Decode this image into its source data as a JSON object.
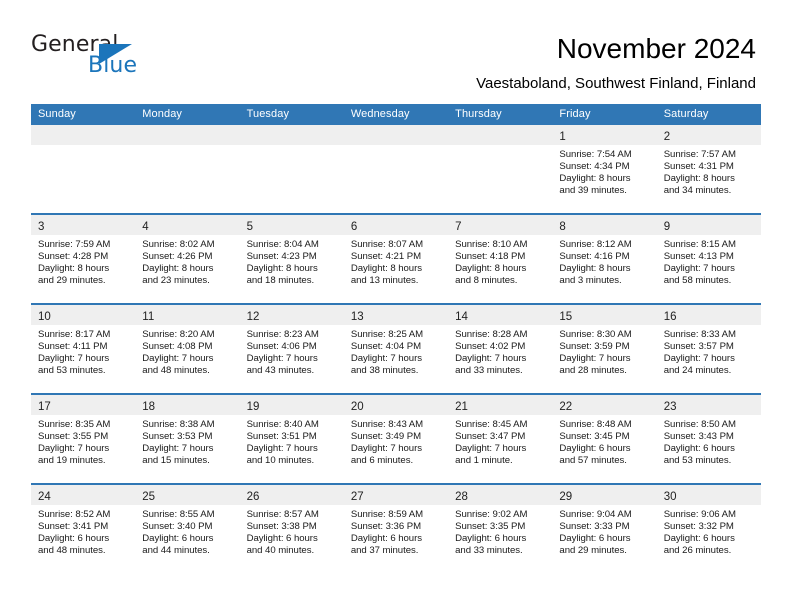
{
  "brand": {
    "name_part1": "General",
    "name_part2": "Blue",
    "accent_color": "#1b75bb",
    "logo_icon": "triangle-flag-icon"
  },
  "header": {
    "title": "November 2024",
    "subtitle": "Vaestaboland, Southwest Finland, Finland"
  },
  "theme": {
    "header_blue": "#3077b5",
    "date_strip_gray": "#efefef",
    "text_color": "#1a1a1a"
  },
  "weekday_headers": [
    "Sunday",
    "Monday",
    "Tuesday",
    "Wednesday",
    "Thursday",
    "Friday",
    "Saturday"
  ],
  "weeks": [
    [
      {
        "day": "",
        "lines": []
      },
      {
        "day": "",
        "lines": []
      },
      {
        "day": "",
        "lines": []
      },
      {
        "day": "",
        "lines": []
      },
      {
        "day": "",
        "lines": []
      },
      {
        "day": "1",
        "lines": [
          "Sunrise: 7:54 AM",
          "Sunset: 4:34 PM",
          "Daylight: 8 hours",
          "and 39 minutes."
        ]
      },
      {
        "day": "2",
        "lines": [
          "Sunrise: 7:57 AM",
          "Sunset: 4:31 PM",
          "Daylight: 8 hours",
          "and 34 minutes."
        ]
      }
    ],
    [
      {
        "day": "3",
        "lines": [
          "Sunrise: 7:59 AM",
          "Sunset: 4:28 PM",
          "Daylight: 8 hours",
          "and 29 minutes."
        ]
      },
      {
        "day": "4",
        "lines": [
          "Sunrise: 8:02 AM",
          "Sunset: 4:26 PM",
          "Daylight: 8 hours",
          "and 23 minutes."
        ]
      },
      {
        "day": "5",
        "lines": [
          "Sunrise: 8:04 AM",
          "Sunset: 4:23 PM",
          "Daylight: 8 hours",
          "and 18 minutes."
        ]
      },
      {
        "day": "6",
        "lines": [
          "Sunrise: 8:07 AM",
          "Sunset: 4:21 PM",
          "Daylight: 8 hours",
          "and 13 minutes."
        ]
      },
      {
        "day": "7",
        "lines": [
          "Sunrise: 8:10 AM",
          "Sunset: 4:18 PM",
          "Daylight: 8 hours",
          "and 8 minutes."
        ]
      },
      {
        "day": "8",
        "lines": [
          "Sunrise: 8:12 AM",
          "Sunset: 4:16 PM",
          "Daylight: 8 hours",
          "and 3 minutes."
        ]
      },
      {
        "day": "9",
        "lines": [
          "Sunrise: 8:15 AM",
          "Sunset: 4:13 PM",
          "Daylight: 7 hours",
          "and 58 minutes."
        ]
      }
    ],
    [
      {
        "day": "10",
        "lines": [
          "Sunrise: 8:17 AM",
          "Sunset: 4:11 PM",
          "Daylight: 7 hours",
          "and 53 minutes."
        ]
      },
      {
        "day": "11",
        "lines": [
          "Sunrise: 8:20 AM",
          "Sunset: 4:08 PM",
          "Daylight: 7 hours",
          "and 48 minutes."
        ]
      },
      {
        "day": "12",
        "lines": [
          "Sunrise: 8:23 AM",
          "Sunset: 4:06 PM",
          "Daylight: 7 hours",
          "and 43 minutes."
        ]
      },
      {
        "day": "13",
        "lines": [
          "Sunrise: 8:25 AM",
          "Sunset: 4:04 PM",
          "Daylight: 7 hours",
          "and 38 minutes."
        ]
      },
      {
        "day": "14",
        "lines": [
          "Sunrise: 8:28 AM",
          "Sunset: 4:02 PM",
          "Daylight: 7 hours",
          "and 33 minutes."
        ]
      },
      {
        "day": "15",
        "lines": [
          "Sunrise: 8:30 AM",
          "Sunset: 3:59 PM",
          "Daylight: 7 hours",
          "and 28 minutes."
        ]
      },
      {
        "day": "16",
        "lines": [
          "Sunrise: 8:33 AM",
          "Sunset: 3:57 PM",
          "Daylight: 7 hours",
          "and 24 minutes."
        ]
      }
    ],
    [
      {
        "day": "17",
        "lines": [
          "Sunrise: 8:35 AM",
          "Sunset: 3:55 PM",
          "Daylight: 7 hours",
          "and 19 minutes."
        ]
      },
      {
        "day": "18",
        "lines": [
          "Sunrise: 8:38 AM",
          "Sunset: 3:53 PM",
          "Daylight: 7 hours",
          "and 15 minutes."
        ]
      },
      {
        "day": "19",
        "lines": [
          "Sunrise: 8:40 AM",
          "Sunset: 3:51 PM",
          "Daylight: 7 hours",
          "and 10 minutes."
        ]
      },
      {
        "day": "20",
        "lines": [
          "Sunrise: 8:43 AM",
          "Sunset: 3:49 PM",
          "Daylight: 7 hours",
          "and 6 minutes."
        ]
      },
      {
        "day": "21",
        "lines": [
          "Sunrise: 8:45 AM",
          "Sunset: 3:47 PM",
          "Daylight: 7 hours",
          "and 1 minute."
        ]
      },
      {
        "day": "22",
        "lines": [
          "Sunrise: 8:48 AM",
          "Sunset: 3:45 PM",
          "Daylight: 6 hours",
          "and 57 minutes."
        ]
      },
      {
        "day": "23",
        "lines": [
          "Sunrise: 8:50 AM",
          "Sunset: 3:43 PM",
          "Daylight: 6 hours",
          "and 53 minutes."
        ]
      }
    ],
    [
      {
        "day": "24",
        "lines": [
          "Sunrise: 8:52 AM",
          "Sunset: 3:41 PM",
          "Daylight: 6 hours",
          "and 48 minutes."
        ]
      },
      {
        "day": "25",
        "lines": [
          "Sunrise: 8:55 AM",
          "Sunset: 3:40 PM",
          "Daylight: 6 hours",
          "and 44 minutes."
        ]
      },
      {
        "day": "26",
        "lines": [
          "Sunrise: 8:57 AM",
          "Sunset: 3:38 PM",
          "Daylight: 6 hours",
          "and 40 minutes."
        ]
      },
      {
        "day": "27",
        "lines": [
          "Sunrise: 8:59 AM",
          "Sunset: 3:36 PM",
          "Daylight: 6 hours",
          "and 37 minutes."
        ]
      },
      {
        "day": "28",
        "lines": [
          "Sunrise: 9:02 AM",
          "Sunset: 3:35 PM",
          "Daylight: 6 hours",
          "and 33 minutes."
        ]
      },
      {
        "day": "29",
        "lines": [
          "Sunrise: 9:04 AM",
          "Sunset: 3:33 PM",
          "Daylight: 6 hours",
          "and 29 minutes."
        ]
      },
      {
        "day": "30",
        "lines": [
          "Sunrise: 9:06 AM",
          "Sunset: 3:32 PM",
          "Daylight: 6 hours",
          "and 26 minutes."
        ]
      }
    ]
  ]
}
